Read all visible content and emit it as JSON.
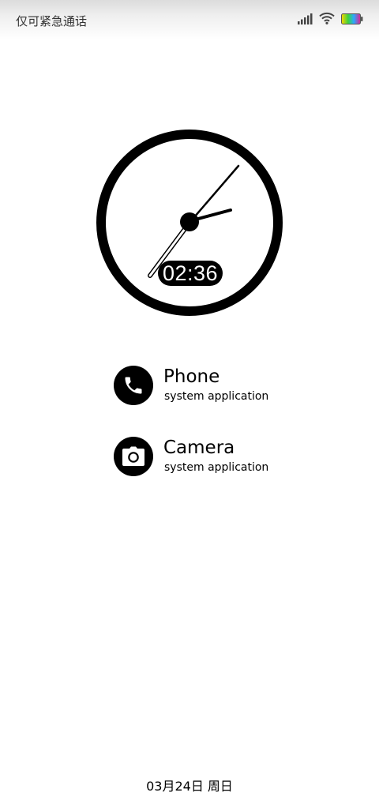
{
  "status_bar": {
    "carrier_text": "仅可紧急通话",
    "icons": [
      "signal-icon",
      "wifi-icon",
      "battery-icon"
    ],
    "colors": {
      "battery_gradient": [
        "#ffd400",
        "#3cd33c",
        "#2aa8ff",
        "#e0228a"
      ]
    }
  },
  "clock": {
    "digital_time": "02:36"
  },
  "apps": [
    {
      "name": "Phone",
      "subtitle": "system application",
      "icon": "phone-icon"
    },
    {
      "name": "Camera",
      "subtitle": "system application",
      "icon": "camera-icon"
    }
  ],
  "footer": {
    "date_text": "03月24日 周日"
  }
}
